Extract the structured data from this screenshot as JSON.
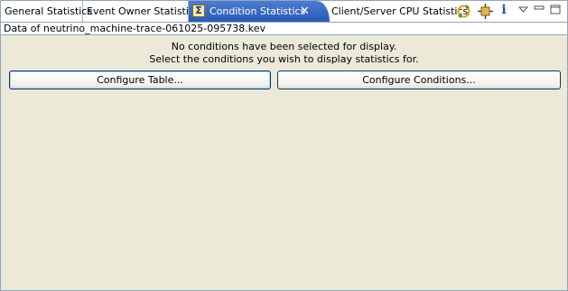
{
  "tabs": [
    {
      "label": "General Statistics"
    },
    {
      "label": "Event Owner Statistics"
    },
    {
      "label": "Condition Statistics",
      "active": true
    },
    {
      "label": "Client/Server CPU Statistics"
    }
  ],
  "toolbar": {
    "icons": [
      "refresh-icon",
      "pin-icon",
      "info-icon",
      "view-menu-icon",
      "minimize-icon",
      "maximize-icon"
    ],
    "info_glyph": "i"
  },
  "status": {
    "data_label": "Data of neutrino_machine-trace-061025-095738.kev"
  },
  "message": {
    "line1": "No conditions have been selected for display.",
    "line2": "Select the conditions you wish to display statistics for."
  },
  "buttons": {
    "configure_table": "Configure Table...",
    "configure_conditions": "Configure Conditions..."
  },
  "colors": {
    "active_tab": "#2a5ab6",
    "panel_bg": "#ece9d8",
    "border": "#8fa6bf"
  }
}
